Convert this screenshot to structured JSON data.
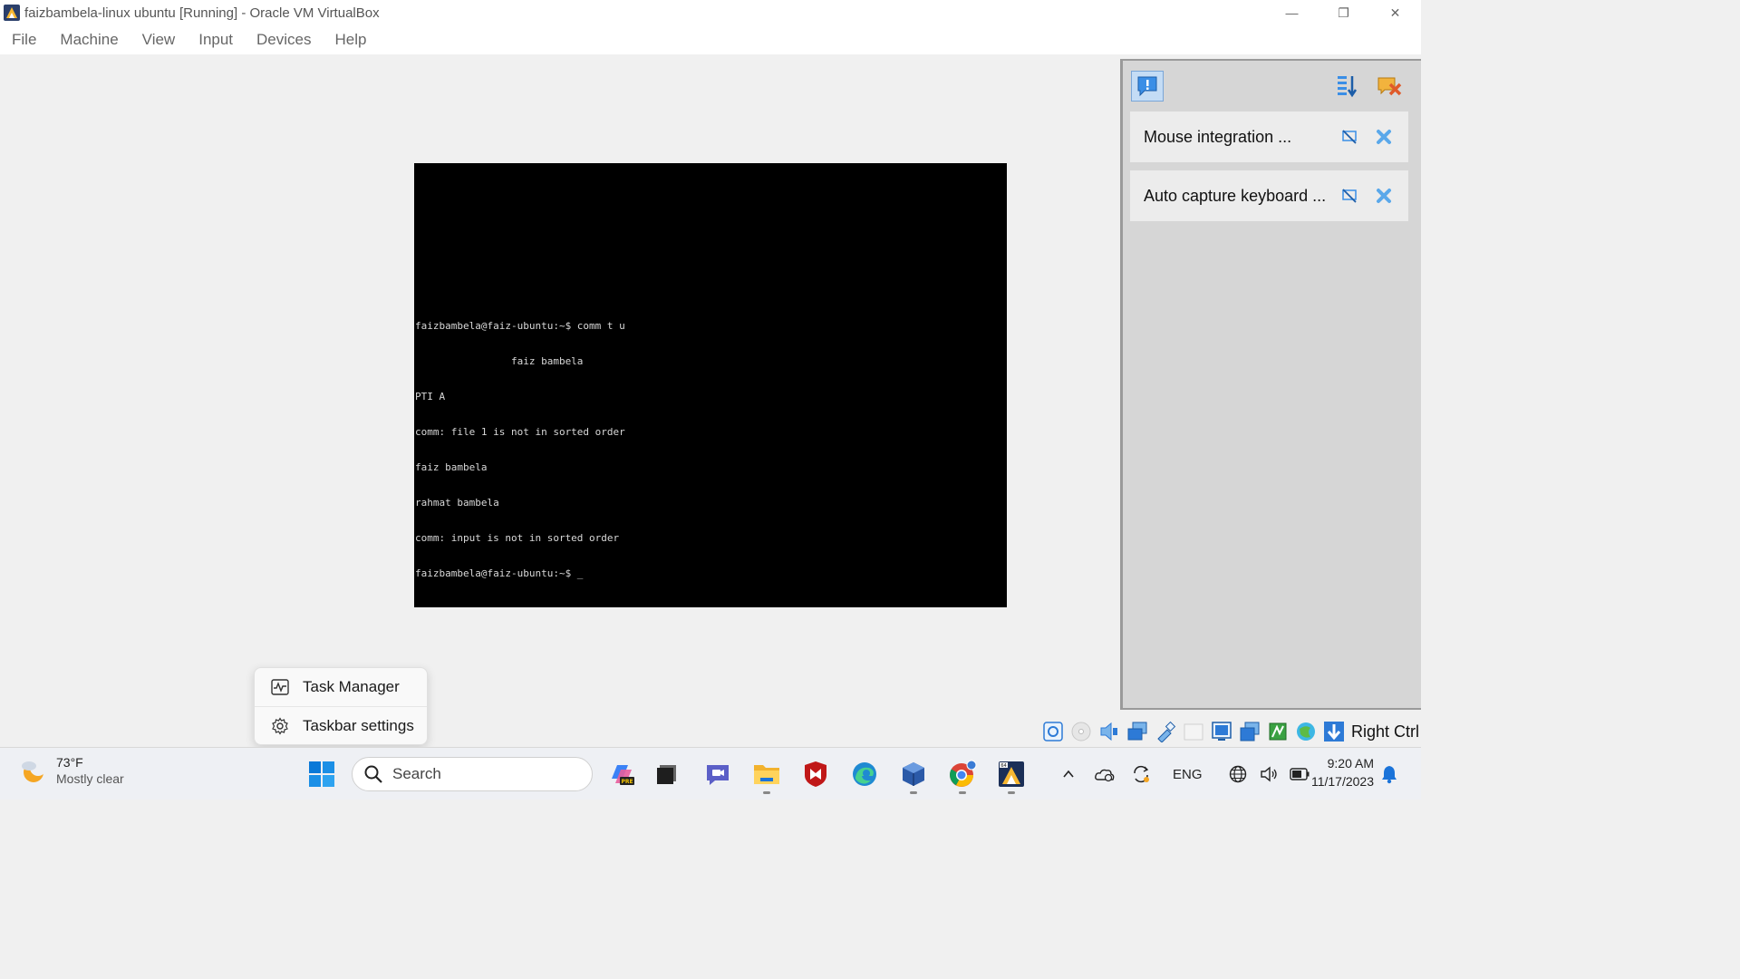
{
  "window": {
    "title": "faizbambela-linux ubuntu [Running] - Oracle VM VirtualBox",
    "controls": {
      "minimize": "—",
      "restore": "❐",
      "close": "✕"
    }
  },
  "menubar": {
    "items": [
      "File",
      "Machine",
      "View",
      "Input",
      "Devices",
      "Help"
    ]
  },
  "console": {
    "lines": [
      "faizbambela@faiz-ubuntu:~$ comm t u",
      "                faiz bambela",
      "PTI A",
      "comm: file 1 is not in sorted order",
      "faiz bambela",
      "rahmat bambela",
      "comm: input is not in sorted order",
      "faizbambela@faiz-ubuntu:~$ _"
    ]
  },
  "notifications": {
    "cards": [
      {
        "label": "Mouse integration ..."
      },
      {
        "label": "Auto capture keyboard ..."
      }
    ]
  },
  "statusbar": {
    "icons": [
      "hard-disk-icon",
      "optical-drive-icon",
      "audio-icon",
      "network-icon",
      "usb-icon",
      "shared-folders-icon",
      "display-icon",
      "recording-icon",
      "cpu-icon",
      "guest-additions-icon",
      "keyboard-capture-icon"
    ],
    "host_key": "Right Ctrl"
  },
  "context_menu": {
    "items": [
      {
        "label": "Task Manager",
        "icon": "task-manager-icon"
      },
      {
        "label": "Taskbar settings",
        "icon": "settings-gear-icon"
      }
    ]
  },
  "taskbar": {
    "weather": {
      "temp": "73°F",
      "condition": "Mostly clear"
    },
    "search": {
      "placeholder": "Search"
    },
    "apps": [
      "copilot-icon",
      "terminal-icon",
      "teams-chat-icon",
      "file-explorer-icon",
      "mcafee-icon",
      "edge-icon",
      "virtualbox-manager-icon",
      "chrome-icon",
      "virtualbox-vm-icon"
    ],
    "tray": {
      "language": "ENG"
    },
    "clock": {
      "time": "9:20 AM",
      "date": "11/17/2023"
    }
  }
}
